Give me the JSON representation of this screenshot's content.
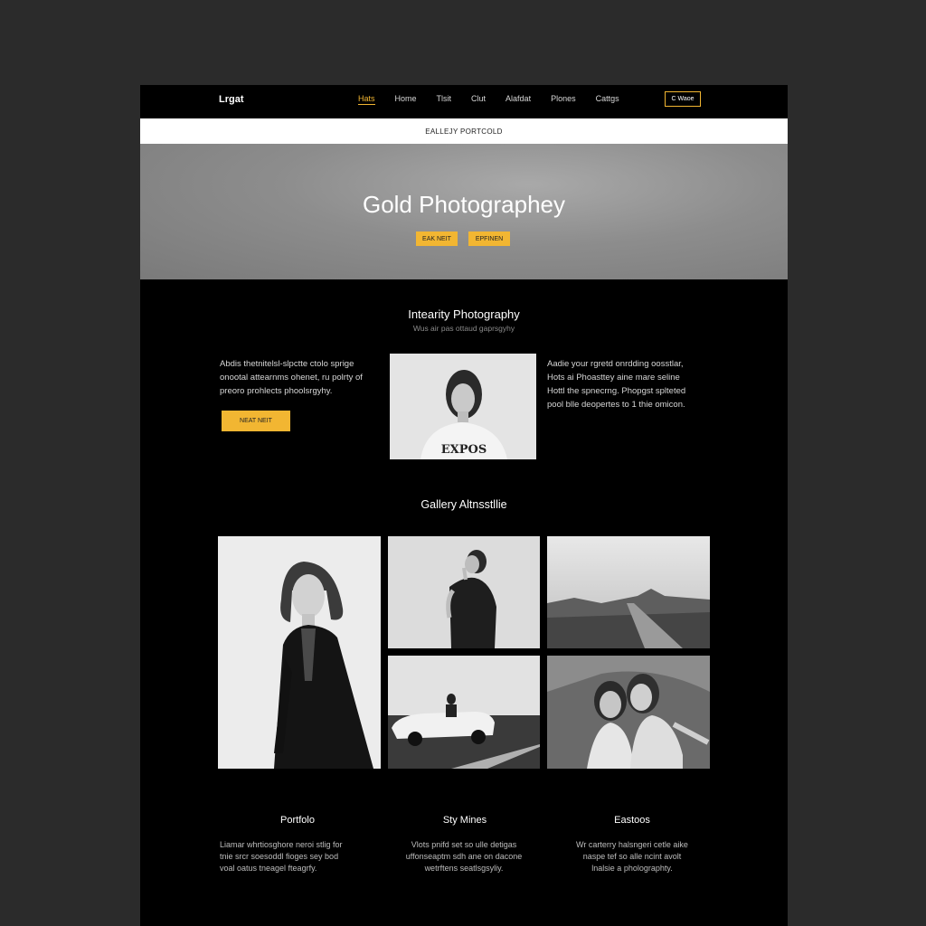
{
  "nav": {
    "logo": "Lrgat",
    "items": [
      "Hats",
      "Home",
      "Tlsit",
      "Clut",
      "Alafdat",
      "Plones",
      "Cattgs"
    ],
    "active_index": 0,
    "cta": "C Waoe"
  },
  "subbar": {
    "label": "EALLEJY PORTCOLD"
  },
  "hero": {
    "title": "Gold Photographey",
    "buttons": [
      "EAK NEIT",
      "EPFINEN"
    ]
  },
  "about": {
    "title": "Intearity Photography",
    "subtitle": "Wus air pas ottaud gaprsgyhy",
    "left_lines": [
      "Abdis thetnitelsl-slpctte ctolo sprige",
      "onootal attearnms ohenet, ru polrty of",
      "preoro prohlects phoolsrgyhy."
    ],
    "right_lines": [
      "Aadie your rgretd onrdding oosstlar,",
      "Hots ai Phoasttey aine mare seline",
      "Hottl the spnecrng. Phopgst splteted",
      "pool blle deopertes to 1 thie omicon."
    ],
    "button": "NEAT NEIT"
  },
  "gallery": {
    "title": "Gallery Altnsstllie"
  },
  "columns": [
    {
      "title": "Portfolo",
      "lines": [
        "Liamar whrtiosghore neroi stlig for",
        "tnie srcr soesoddl fioges sey bod",
        "voal oatus tneagel fteagrfy."
      ]
    },
    {
      "title": "Sty Mines",
      "lines": [
        "Vlots pnifd set so ulle detigas",
        "uffonseaptm sdh ane on dacone",
        "wetrftens seatlsgsyliy."
      ]
    },
    {
      "title": "Eastoos",
      "lines": [
        "Wr carterry halsngeri cetle aike",
        "naspe tef so alle ncint avolt",
        "lnalsie a pholographty."
      ]
    }
  ],
  "colors": {
    "accent": "#f2b632",
    "page_bg": "#000000",
    "outer_bg": "#2b2b2b"
  }
}
